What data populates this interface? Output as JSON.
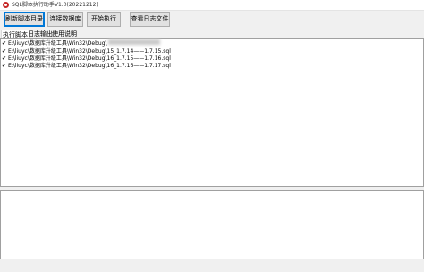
{
  "window": {
    "title": "SQL脚本执行助手V1.0(20221212)"
  },
  "toolbar": {
    "refresh_label": "刷新脚本目录",
    "connect_label": "连接数据库",
    "execute_label": "开始执行",
    "viewlog_label": "查看日志文件"
  },
  "tabs": [
    {
      "label": "执行脚本"
    },
    {
      "label": "日志输出"
    },
    {
      "label": "使用说明"
    }
  ],
  "script_list": [
    {
      "check": "✔",
      "path": "E:\\liuyc\\数据库升级工具\\Win32\\Debug\\"
    },
    {
      "check": "✔",
      "path": "E:\\liuyc\\数据库升级工具\\Win32\\Debug\\15_1.7.14——1.7.15.sql"
    },
    {
      "check": "✔",
      "path": "E:\\liuyc\\数据库升级工具\\Win32\\Debug\\16_1.7.15——1.7.16.sql"
    },
    {
      "check": "✔",
      "path": "E:\\liuyc\\数据库升级工具\\Win32\\Debug\\16_1.7.16——1.7.17.sql"
    }
  ],
  "colors": {
    "accent": "#0078d7",
    "app_icon": "#c62828"
  }
}
